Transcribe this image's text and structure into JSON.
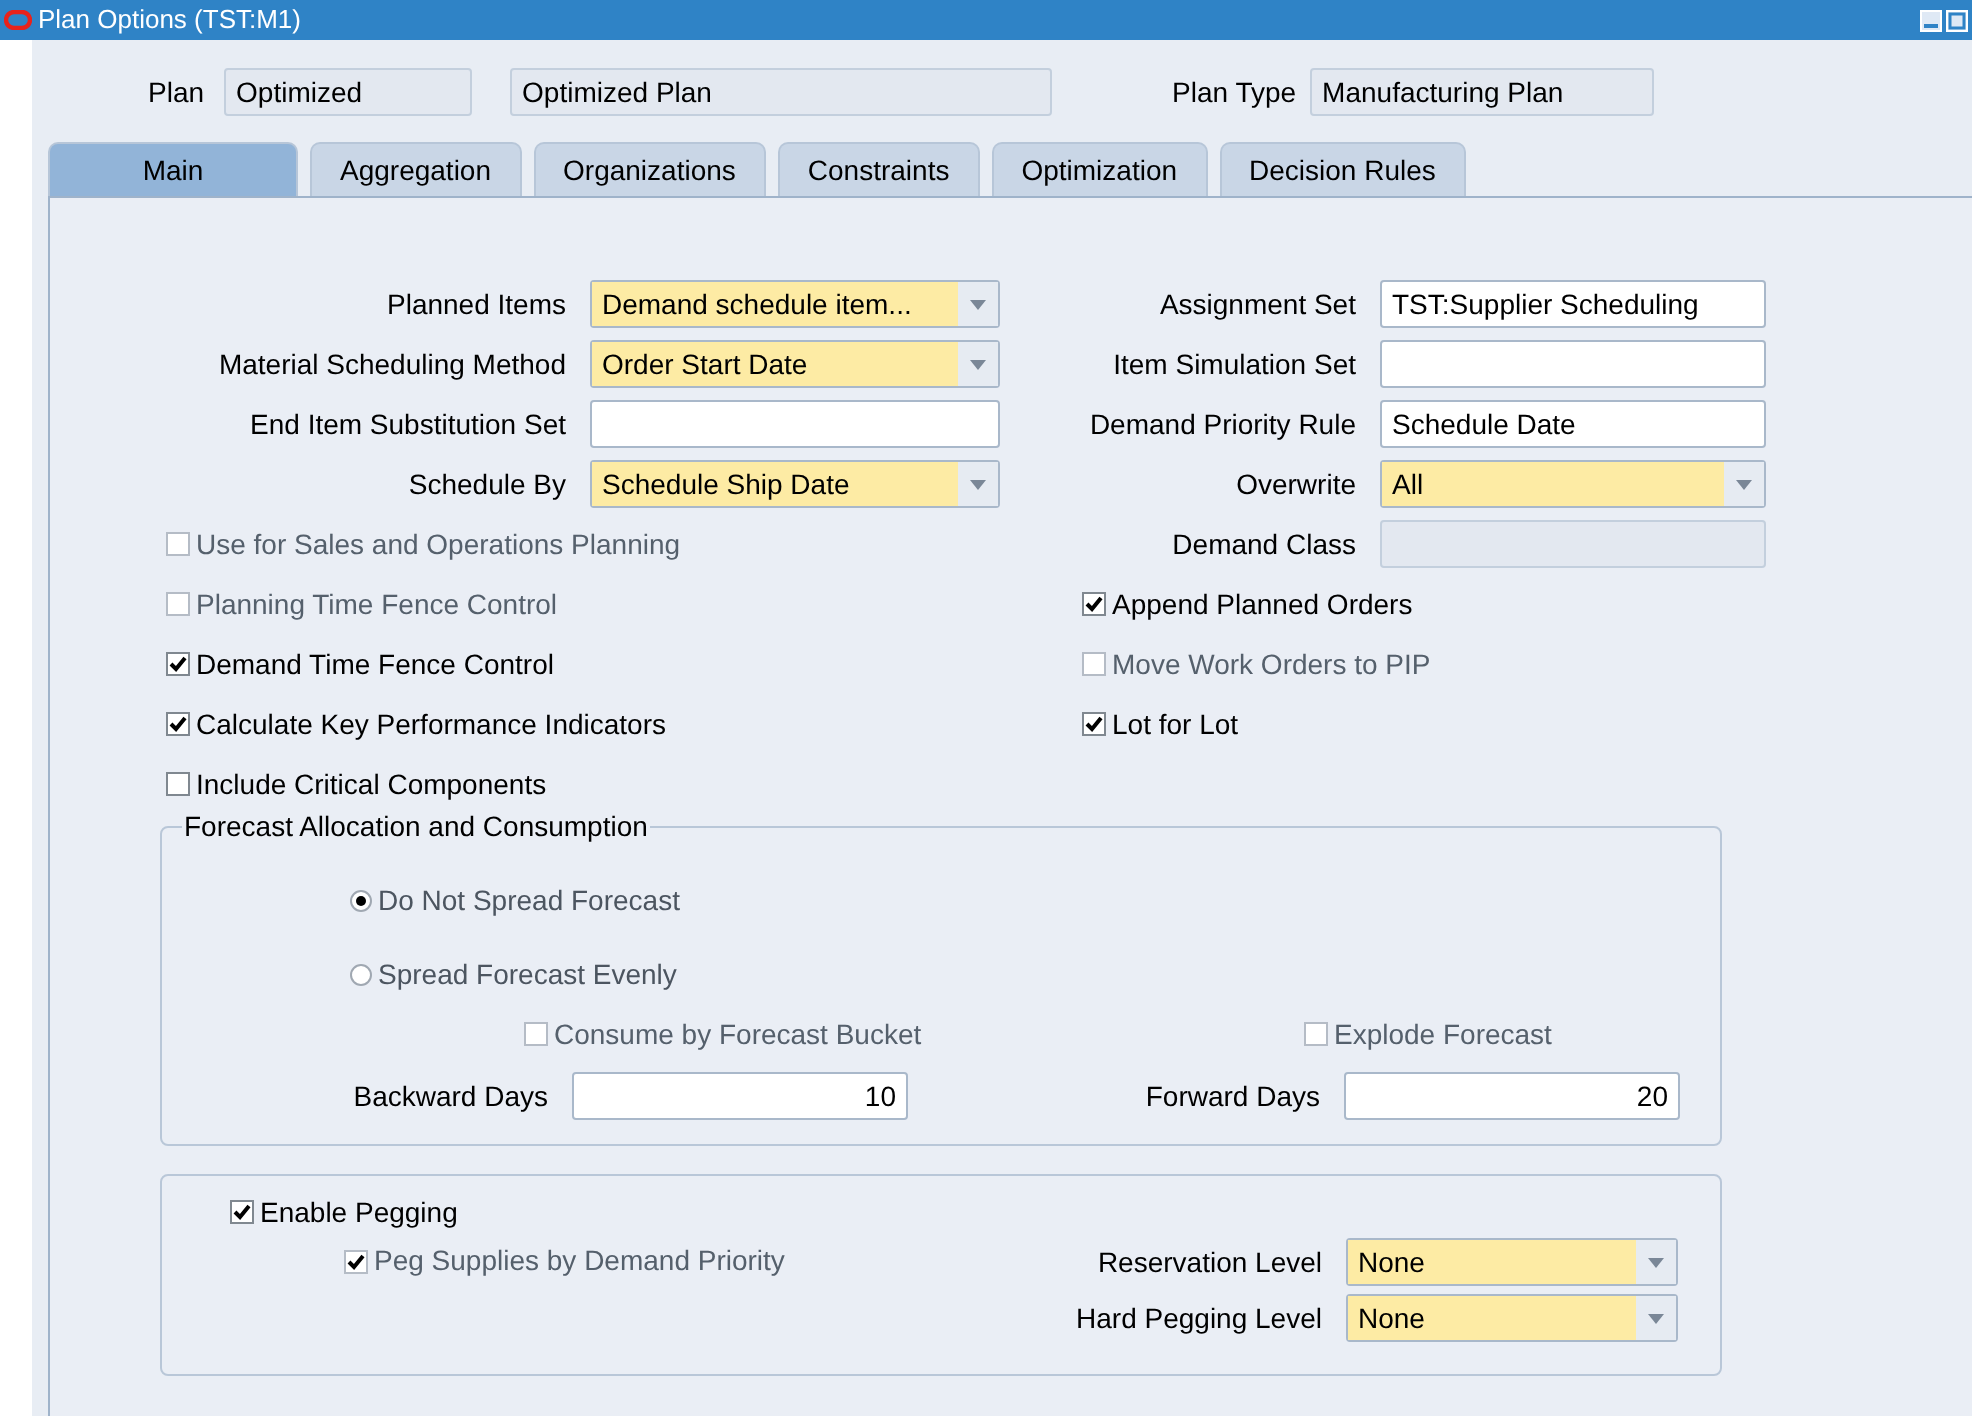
{
  "window": {
    "title": "Plan Options (TST:M1)"
  },
  "header": {
    "plan_label": "Plan",
    "plan_name": "Optimized",
    "plan_description": "Optimized Plan",
    "plan_type_label": "Plan Type",
    "plan_type": "Manufacturing Plan"
  },
  "tabs": [
    {
      "label": "Main",
      "selected": true
    },
    {
      "label": "Aggregation",
      "selected": false
    },
    {
      "label": "Organizations",
      "selected": false
    },
    {
      "label": "Constraints",
      "selected": false
    },
    {
      "label": "Optimization",
      "selected": false
    },
    {
      "label": "Decision Rules",
      "selected": false
    }
  ],
  "left_column": [
    {
      "kind": "dropdown",
      "label": "Planned Items",
      "value": "Demand schedule item..."
    },
    {
      "kind": "dropdown",
      "label": "Material Scheduling Method",
      "value": "Order Start Date"
    },
    {
      "kind": "text",
      "label": "End Item Substitution Set"
    },
    {
      "kind": "dropdown",
      "label": "Schedule By",
      "value": "Schedule Ship Date"
    },
    {
      "kind": "checkbox",
      "label": "Use for Sales and Operations Planning",
      "checked": false,
      "disabled": true
    },
    {
      "kind": "checkbox",
      "label": "Planning Time Fence Control",
      "checked": false,
      "disabled": true
    },
    {
      "kind": "checkbox",
      "label": "Demand Time Fence Control",
      "checked": true,
      "disabled": false
    },
    {
      "kind": "checkbox",
      "label": "Calculate Key Performance Indicators",
      "checked": true,
      "disabled": false
    },
    {
      "kind": "checkbox",
      "label": "Include Critical Components",
      "checked": false,
      "disabled": false
    }
  ],
  "right_column": [
    {
      "kind": "text",
      "label": "Assignment Set",
      "value": "TST:Supplier Scheduling",
      "disabled": false
    },
    {
      "kind": "text",
      "label": "Item Simulation Set",
      "disabled": false
    },
    {
      "kind": "text",
      "label": "Demand Priority Rule",
      "value": "Schedule Date",
      "disabled": false
    },
    {
      "kind": "dropdown",
      "label": "Overwrite",
      "value": "All"
    },
    {
      "kind": "text",
      "label": "Demand Class",
      "disabled": true
    },
    {
      "kind": "checkbox",
      "label": "Append Planned Orders",
      "checked": true,
      "disabled": false
    },
    {
      "kind": "checkbox",
      "label": "Move Work Orders to PIP",
      "checked": false,
      "disabled": true
    },
    {
      "kind": "checkbox",
      "label": "Lot for Lot",
      "checked": true,
      "disabled": false
    }
  ],
  "forecast": {
    "title": "Forecast Allocation and Consumption",
    "radios": [
      {
        "label": "Do Not Spread Forecast",
        "selected": true
      },
      {
        "label": "Spread Forecast Evenly",
        "selected": false
      }
    ],
    "consume": {
      "label": "Consume by Forecast Bucket",
      "checked": false,
      "disabled": true
    },
    "explode": {
      "label": "Explode Forecast",
      "checked": false,
      "disabled": true
    },
    "backward_days": {
      "label": "Backward Days",
      "value": "10"
    },
    "forward_days": {
      "label": "Forward Days",
      "value": "20"
    }
  },
  "pegging": {
    "enable": {
      "label": "Enable Pegging",
      "checked": true,
      "disabled": false
    },
    "by_priority": {
      "label": "Peg Supplies by Demand Priority",
      "checked": true,
      "disabled": true
    },
    "reservation_level": {
      "label": "Reservation Level",
      "value": "None"
    },
    "hard_pegging_level": {
      "label": "Hard Pegging Level",
      "value": "None"
    }
  }
}
